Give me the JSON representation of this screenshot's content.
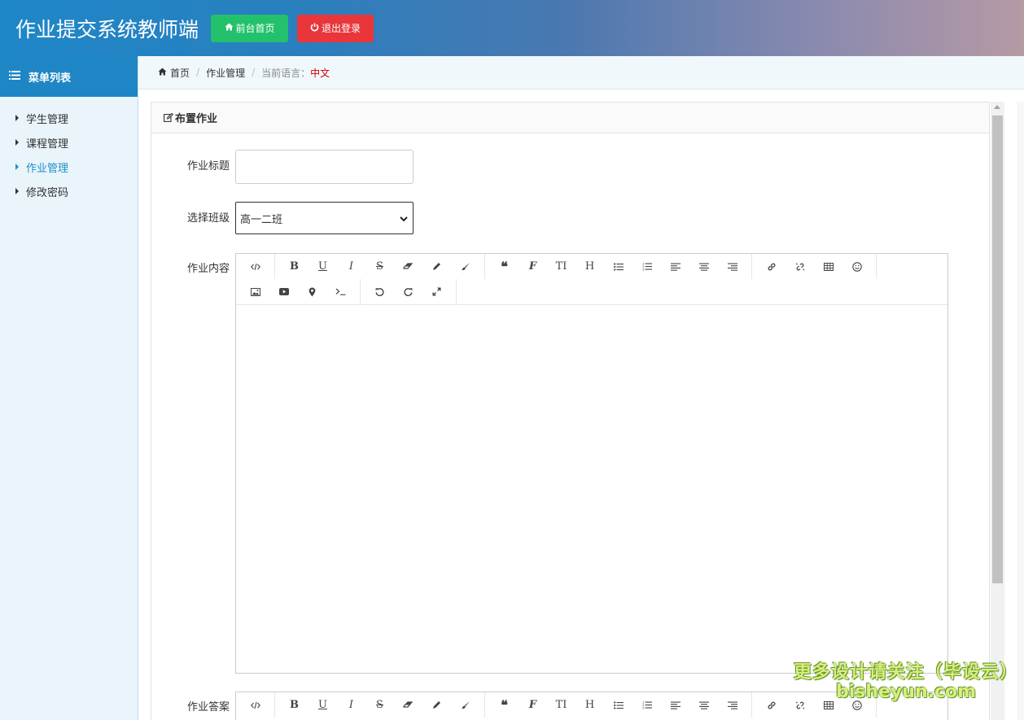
{
  "header": {
    "title": "作业提交系统教师端",
    "home_button": "前台首页",
    "logout_button": "退出登录"
  },
  "sidebar": {
    "heading": "菜单列表",
    "items": [
      {
        "label": "学生管理"
      },
      {
        "label": "课程管理"
      },
      {
        "label": "作业管理"
      },
      {
        "label": "修改密码"
      }
    ]
  },
  "breadcrumb": {
    "home": "首页",
    "section": "作业管理",
    "language_label": "当前语言：",
    "language_value": "中文"
  },
  "panel": {
    "title": "布置作业"
  },
  "form": {
    "title_label": "作业标题",
    "title_value": "",
    "class_label": "选择班级",
    "class_selected": "高一二班",
    "content_label": "作业内容",
    "answer_label": "作业答案"
  },
  "editor": {
    "toolbar_row1": [
      "code-view-icon",
      "bold-icon",
      "underline-icon",
      "italic-icon",
      "strikethrough-icon",
      "eraser-icon",
      "pencil-icon",
      "brush-icon",
      "quote-icon",
      "font-icon",
      "text-height-icon",
      "heading-icon",
      "bullet-list-icon",
      "numbered-list-icon",
      "align-left-icon",
      "align-center-icon",
      "align-right-icon",
      "link-icon",
      "unlink-icon",
      "table-icon",
      "emoji-icon"
    ],
    "toolbar_row2": [
      "image-icon",
      "video-icon",
      "location-icon",
      "terminal-icon",
      "undo-icon",
      "redo-icon",
      "fullscreen-icon"
    ]
  },
  "watermark": {
    "line1": "更多设计请关注（毕设云）",
    "line2": "bisheyun.com"
  },
  "colors": {
    "home_button": "#23c16b",
    "logout_button": "#e8363b",
    "sidebar_header": "#1e86c5",
    "active_item": "#1e90c8",
    "language_value": "#cc0000"
  }
}
